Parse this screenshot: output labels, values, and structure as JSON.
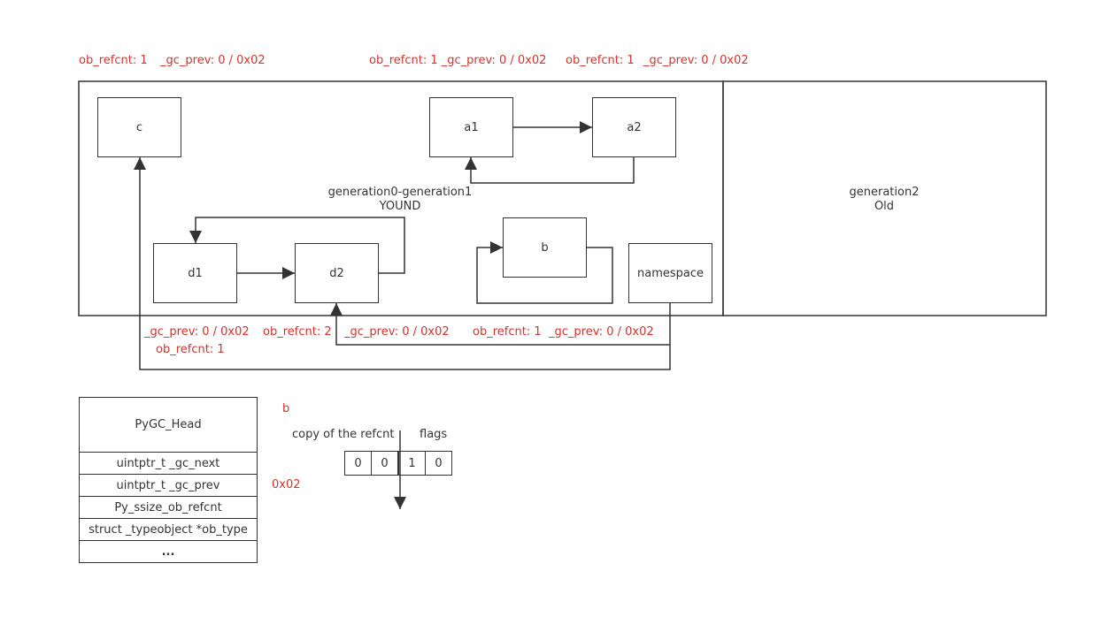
{
  "colors": {
    "annotation": "#d9312c",
    "stroke": "#333333",
    "text": "#333333"
  },
  "nodes": {
    "c": "c",
    "a1": "a1",
    "a2": "a2",
    "d1": "d1",
    "d2": "d2",
    "b": "b",
    "namespace": "namespace"
  },
  "regions": {
    "young_line1": "generation0-generation1",
    "young_line2": "YOUND",
    "old_line1": "generation2",
    "old_line2": "Old"
  },
  "annotations": {
    "c_refcnt": "ob_refcnt: 1",
    "c_gc_prev": "_gc_prev: 0 / 0x02",
    "a1_refcnt_gc_prev": "ob_refcnt: 1 _gc_prev: 0 / 0x02",
    "a2_refcnt": "ob_refcnt: 1",
    "a2_gc_prev": "_gc_prev: 0 / 0x02",
    "d1_gc_prev": "_gc_prev: 0 / 0x02",
    "d1_refcnt": "ob_refcnt: 1",
    "d2_refcnt": "ob_refcnt: 2",
    "d2_gc_prev": "_gc_prev: 0 / 0x02",
    "b_refcnt": "ob_refcnt: 1",
    "b_gc_prev": "_gc_prev: 0 / 0x02"
  },
  "pygc_head": {
    "title": "PyGC_Head",
    "rows": [
      "uintptr_t _gc_next",
      "uintptr_t _gc_prev",
      "Py_ssize_ob_refcnt",
      "struct _typeobject *ob_type",
      "..."
    ],
    "prev_value": "0x02"
  },
  "bits": {
    "object_label": "b",
    "left_label": "copy of the refcnt",
    "right_label": "flags",
    "values": [
      "0",
      "0",
      "1",
      "0"
    ]
  }
}
